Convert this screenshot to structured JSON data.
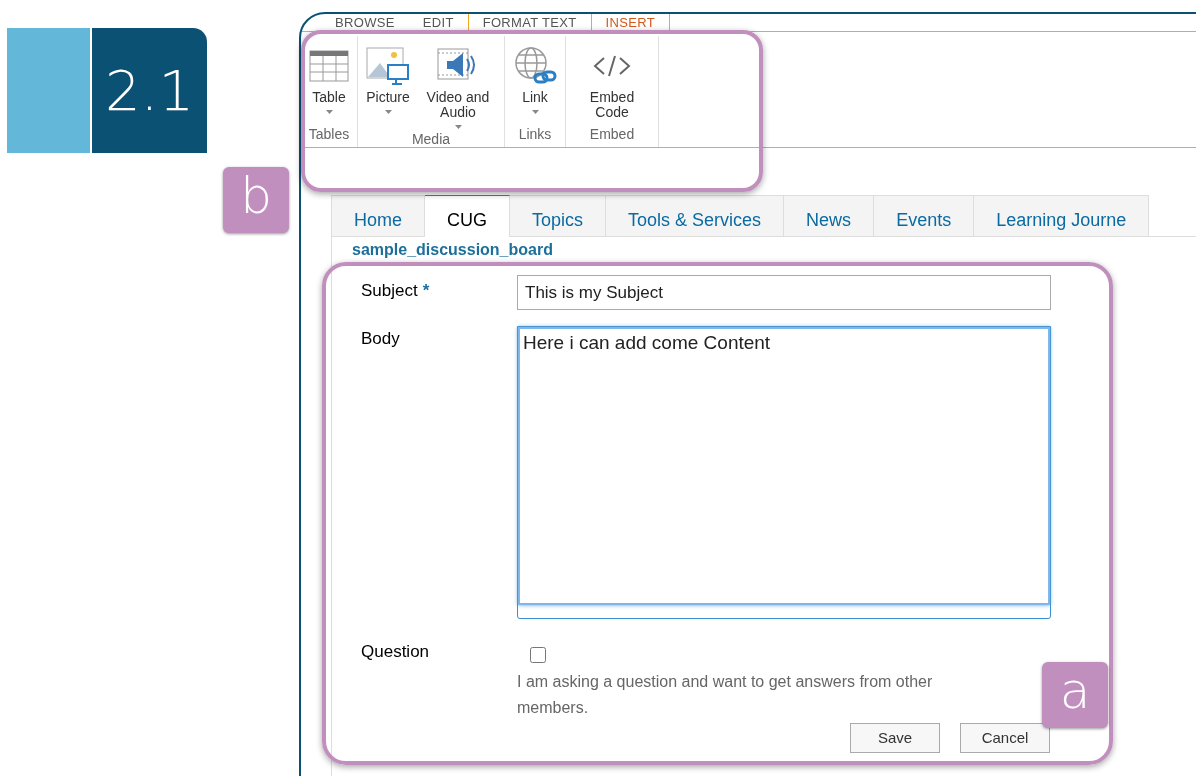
{
  "badge": {
    "number": "2.1"
  },
  "ribbon_tabs": [
    {
      "label": "BROWSE",
      "selected": false
    },
    {
      "label": "EDIT",
      "selected": false
    },
    {
      "label": "FORMAT TEXT",
      "selected": false
    },
    {
      "label": "INSERT",
      "selected": true
    }
  ],
  "ribbon_groups": [
    {
      "label": "Tables",
      "commands": [
        {
          "label": "Table",
          "kind": "table",
          "dropdown": true
        }
      ]
    },
    {
      "label": "Media",
      "commands": [
        {
          "label": "Picture",
          "kind": "picture",
          "dropdown": true
        },
        {
          "label": "Video and Audio",
          "kind": "video",
          "dropdown": true
        }
      ]
    },
    {
      "label": "Links",
      "commands": [
        {
          "label": "Link",
          "kind": "link",
          "dropdown": true
        }
      ]
    },
    {
      "label": "Embed",
      "commands": [
        {
          "label": "Embed Code",
          "kind": "embed",
          "dropdown": false
        }
      ]
    }
  ],
  "callouts": [
    {
      "label": "b"
    },
    {
      "label": "a"
    }
  ],
  "nav_tabs": [
    {
      "label": "Home",
      "selected": false
    },
    {
      "label": "CUG",
      "selected": true
    },
    {
      "label": "Topics",
      "selected": false
    },
    {
      "label": "Tools & Services",
      "selected": false
    },
    {
      "label": "News",
      "selected": false
    },
    {
      "label": "Events",
      "selected": false
    },
    {
      "label": "Learning Journe",
      "selected": false
    }
  ],
  "form": {
    "title": "sample_discussion_board",
    "fields": [
      {
        "kind": "text",
        "label": "Subject",
        "required_mark": "*",
        "value": "This is my Subject"
      },
      {
        "kind": "textarea",
        "label": "Body",
        "value": "Here i can add come Content"
      },
      {
        "kind": "checkbox",
        "label": "Question",
        "checked": false,
        "help": "I am asking a question and want to get answers from other members."
      }
    ],
    "buttons": [
      "Save",
      "Cancel"
    ]
  }
}
